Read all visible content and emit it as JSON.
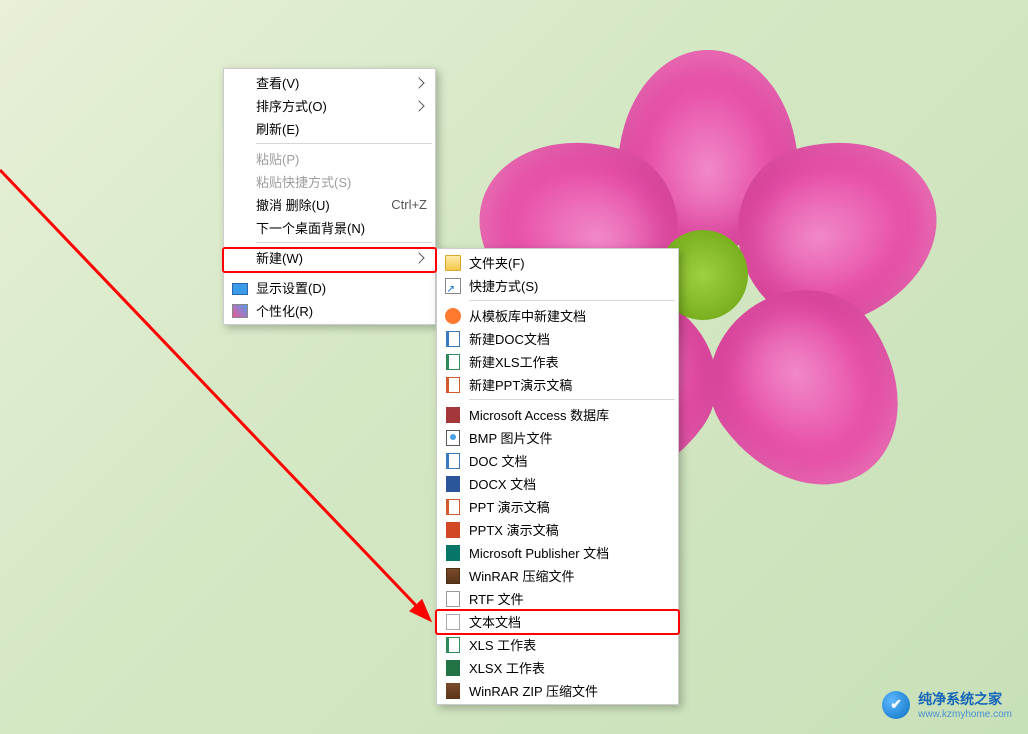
{
  "menu1": {
    "view": "查看(V)",
    "sort": "排序方式(O)",
    "refresh": "刷新(E)",
    "paste": "粘贴(P)",
    "paste_shortcut": "粘贴快捷方式(S)",
    "undo_delete": "撤消 删除(U)",
    "undo_delete_shortcut": "Ctrl+Z",
    "next_bg": "下一个桌面背景(N)",
    "new": "新建(W)",
    "display_settings": "显示设置(D)",
    "personalize": "个性化(R)"
  },
  "menu2": {
    "folder": "文件夹(F)",
    "shortcut": "快捷方式(S)",
    "template_doc": "从模板库中新建文档",
    "new_doc": "新建DOC文档",
    "new_xls": "新建XLS工作表",
    "new_ppt": "新建PPT演示文稿",
    "access": "Microsoft Access 数据库",
    "bmp": "BMP 图片文件",
    "doc": "DOC 文档",
    "docx": "DOCX 文档",
    "ppt": "PPT 演示文稿",
    "pptx": "PPTX 演示文稿",
    "publisher": "Microsoft Publisher 文档",
    "winrar": "WinRAR 压缩文件",
    "rtf": "RTF 文件",
    "txt": "文本文档",
    "xls": "XLS 工作表",
    "xlsx": "XLSX 工作表",
    "winrar_zip": "WinRAR ZIP 压缩文件"
  },
  "watermark": {
    "title": "纯净系统之家",
    "url": "www.kzmyhome.com"
  }
}
